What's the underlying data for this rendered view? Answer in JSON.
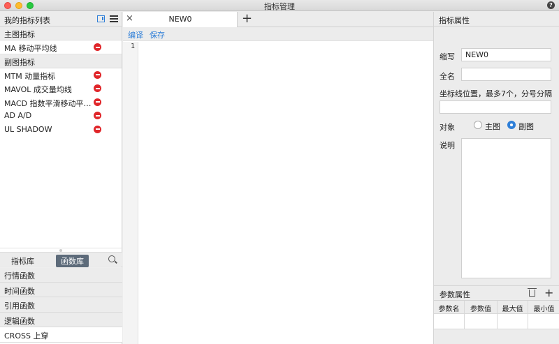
{
  "window": {
    "title": "指标管理"
  },
  "left": {
    "header": "我的指标列表",
    "groups": [
      {
        "title": "主图指标",
        "items": [
          {
            "label": "MA  移动平均线"
          }
        ]
      },
      {
        "title": "副图指标",
        "items": [
          {
            "label": "MTM  动量指标"
          },
          {
            "label": "MAVOL  成交量均线"
          },
          {
            "label": "MACD  指数平滑移动平…"
          },
          {
            "label": "AD  A/D"
          },
          {
            "label": "UL  SHADOW"
          }
        ]
      }
    ],
    "tabs": {
      "library": "指标库",
      "functions": "函数库"
    },
    "function_list": [
      "行情函数",
      "时间函数",
      "引用函数",
      "逻辑函数",
      "CROSS  上穿"
    ]
  },
  "editor": {
    "tab_label": "NEW0",
    "actions": {
      "edit": "编译",
      "save": "保存"
    },
    "line_numbers": [
      "1"
    ]
  },
  "properties": {
    "header": "指标属性",
    "abbr_label": "缩写",
    "abbr_value": "NEW0",
    "fullname_label": "全名",
    "fullname_value": "",
    "axis_label": "坐标线位置，最多7个，分号分隔",
    "axis_value": "",
    "target_label": "对象",
    "target_main": "主图",
    "target_sub": "副图",
    "target_selected": "副图",
    "desc_label": "说明",
    "desc_value": "",
    "params_header": "参数属性",
    "param_columns": [
      "参数名",
      "参数值",
      "最大值",
      "最小值"
    ]
  },
  "colors": {
    "accent": "#2f7fd8",
    "delete": "#e0262a",
    "tab_active": "#5d6b7a"
  }
}
